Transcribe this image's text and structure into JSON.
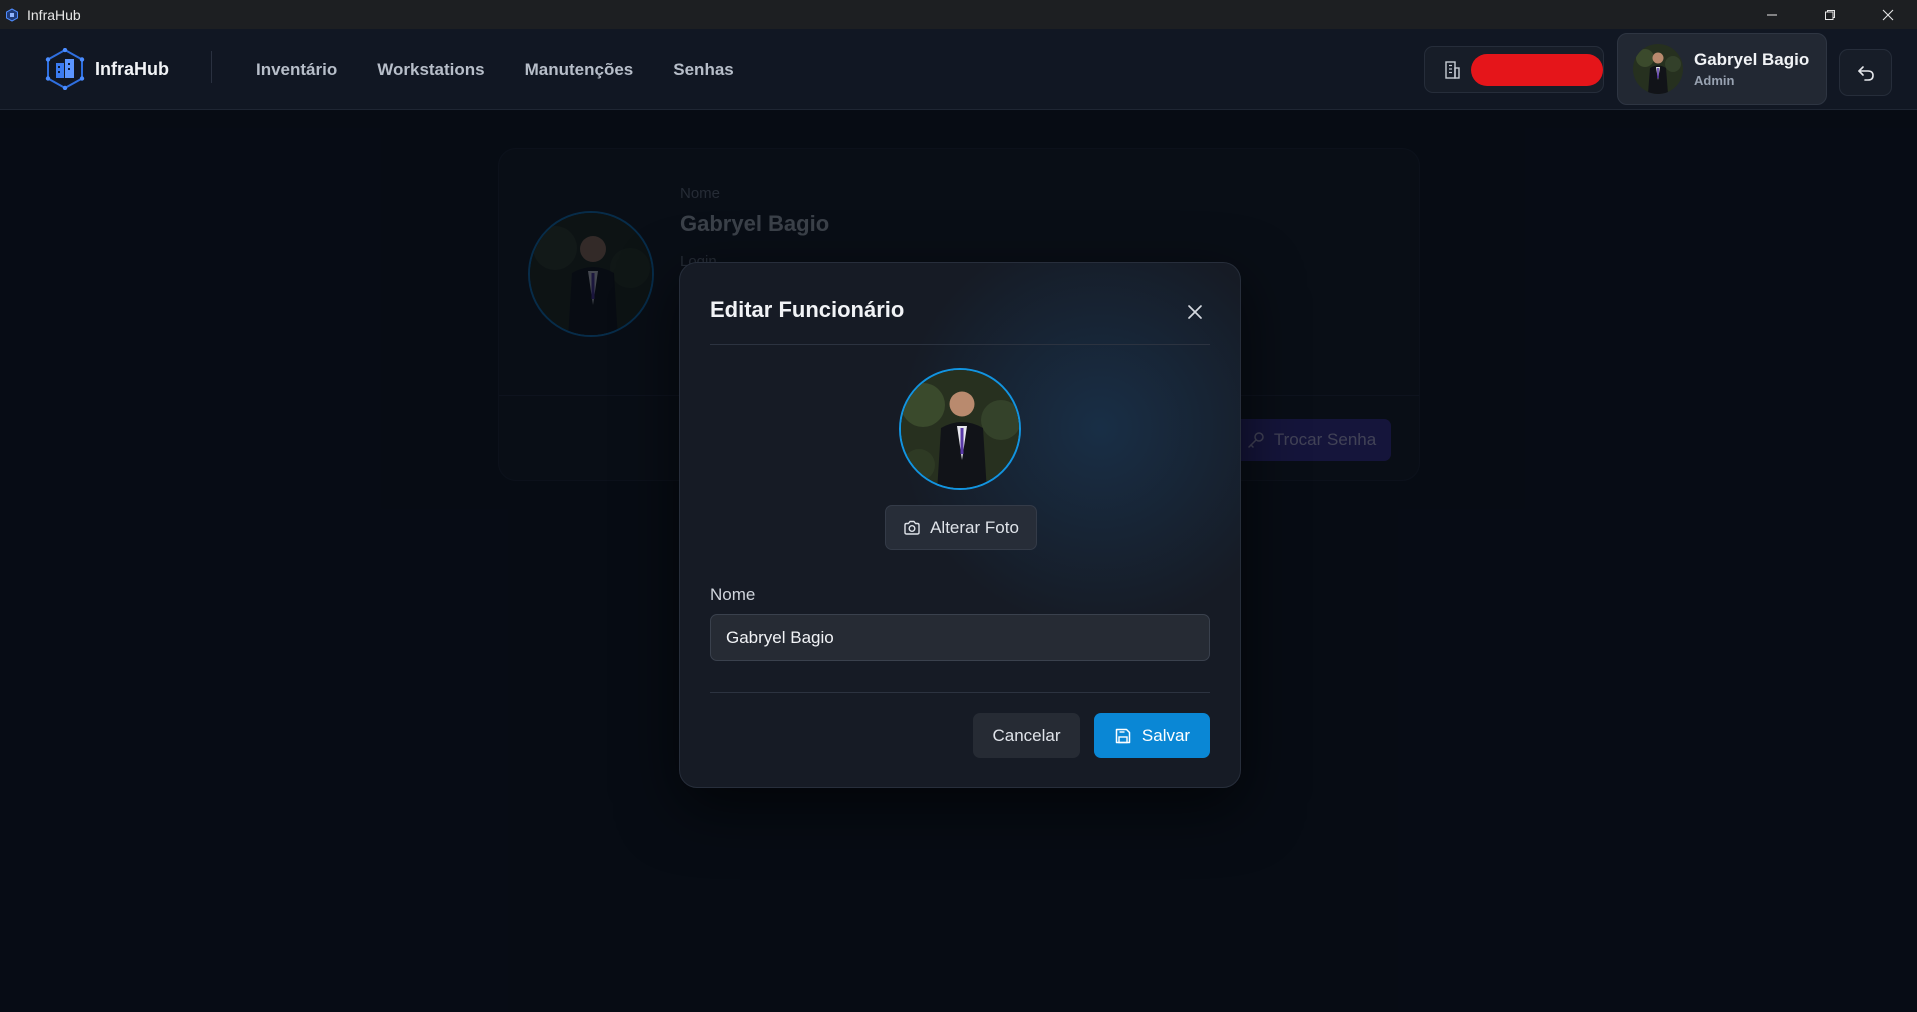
{
  "window": {
    "title": "InfraHub"
  },
  "header": {
    "brand": "InfraHub",
    "nav": [
      {
        "label": "Inventário"
      },
      {
        "label": "Workstations"
      },
      {
        "label": "Manutenções"
      },
      {
        "label": "Senhas"
      }
    ],
    "company_chip": {
      "icon": "building-icon",
      "value_redacted": true
    },
    "user": {
      "name": "Gabryel Bagio",
      "role": "Admin"
    },
    "logout_icon": "undo-icon"
  },
  "background_card": {
    "name_label": "Nome",
    "name_value": "Gabryel Bagio",
    "login_label": "Login",
    "change_password_button": "Trocar Senha"
  },
  "modal": {
    "title": "Editar Funcionário",
    "change_photo_button": "Alterar Foto",
    "name_label": "Nome",
    "name_value": "Gabryel Bagio",
    "cancel_button": "Cancelar",
    "save_button": "Salvar"
  },
  "colors": {
    "accent": "#0a87d5",
    "background": "#0a0f19",
    "modal": "#161b25",
    "redaction": "#e5151a"
  }
}
